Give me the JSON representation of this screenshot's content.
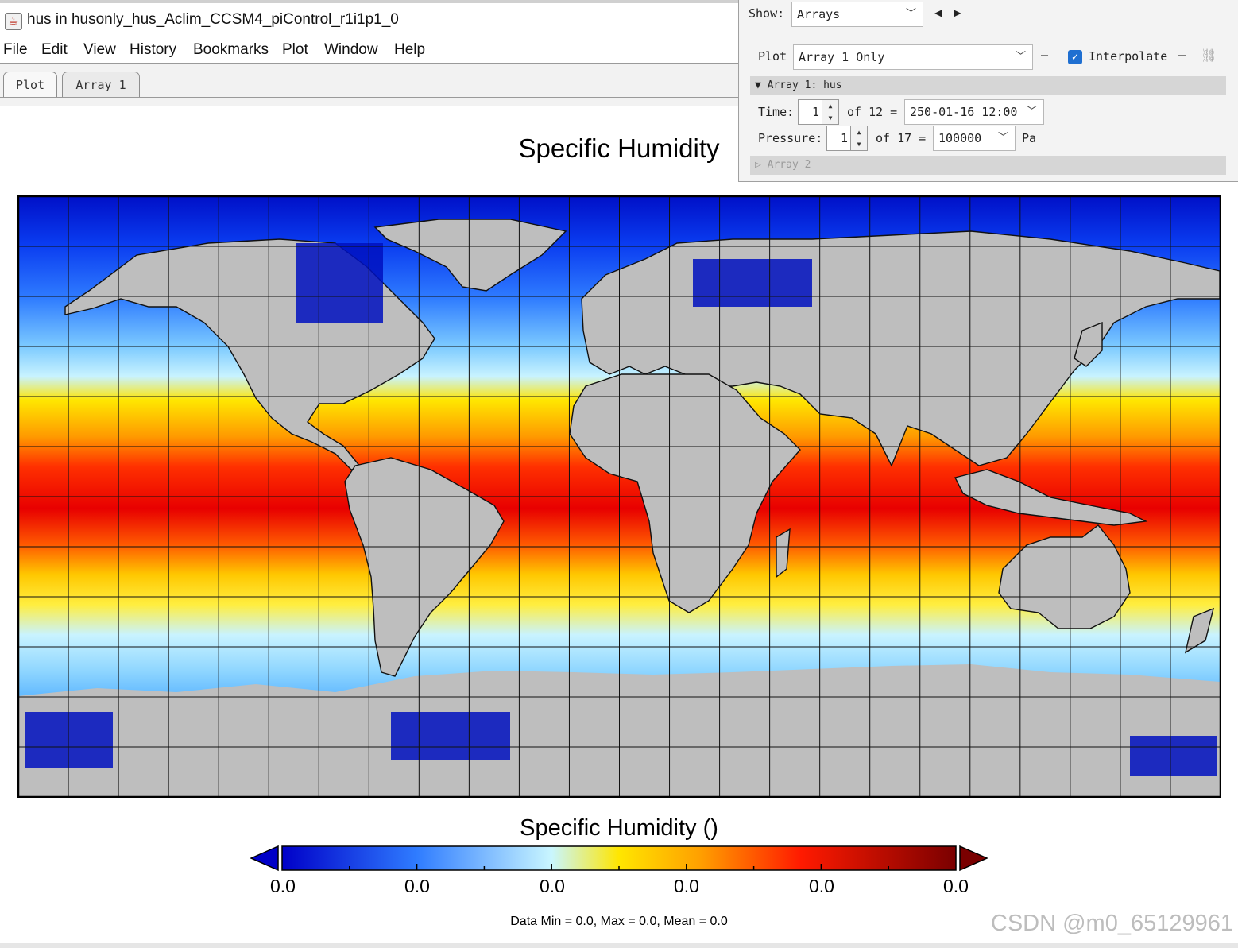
{
  "window": {
    "title": "hus in husonly_hus_Aclim_CCSM4_piControl_r1i1p1_0",
    "app_icon": "java-cup-icon"
  },
  "menu": [
    "File",
    "Edit",
    "View",
    "History",
    "Bookmarks",
    "Plot",
    "Window",
    "Help"
  ],
  "tabs": [
    "Plot",
    "Array 1"
  ],
  "plot": {
    "title": "Specific Humidity",
    "colorbar_title": "Specific Humidity ()",
    "colorbar_ticks": [
      "0.0",
      "0.0",
      "0.0",
      "0.0",
      "0.0",
      "0.0"
    ],
    "stats": "Data Min = 0.0, Max = 0.0, Mean = 0.0",
    "colormap": [
      "#00008f",
      "#0038ff",
      "#4aa8ff",
      "#c8f4ff",
      "#ffe600",
      "#ff9000",
      "#ff1a00",
      "#7a0000"
    ],
    "land_color": "#bebebe",
    "grid": "on"
  },
  "panel": {
    "show_label": "Show:",
    "show_value": "Arrays",
    "prev_icon": "triangle-left-icon",
    "next_icon": "triangle-right-icon",
    "plot_label": "Plot",
    "plot_value": "Array 1 Only",
    "interpolate_label": "Interpolate",
    "interpolate_checked": true,
    "link_icon": "link-icon",
    "array1_header": "Array 1: hus",
    "time_label": "Time:",
    "time_index": "1",
    "time_of": "of 12 =",
    "time_value": "250-01-16 12:00",
    "pressure_label": "Pressure:",
    "pressure_index": "1",
    "pressure_of": "of 17 =",
    "pressure_value": "100000",
    "pressure_unit": "Pa",
    "array2_header": "Array 2"
  },
  "watermark": "CSDN @m0_65129961"
}
